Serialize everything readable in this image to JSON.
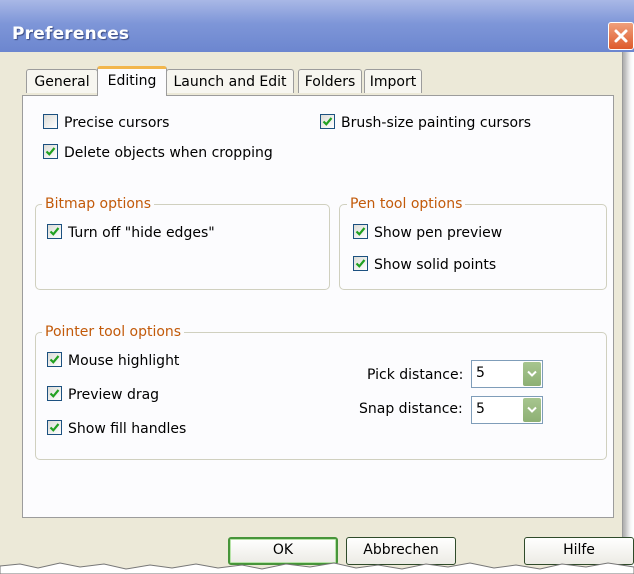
{
  "window": {
    "title": "Preferences"
  },
  "tabs": [
    {
      "label": "General"
    },
    {
      "label": "Editing",
      "active": true
    },
    {
      "label": "Launch and Edit"
    },
    {
      "label": "Folders"
    },
    {
      "label": "Import"
    }
  ],
  "editing": {
    "precise_cursors": {
      "label": "Precise cursors",
      "checked": false
    },
    "brush_size_cursors": {
      "label": "Brush-size painting cursors",
      "checked": true
    },
    "delete_objects_cropping": {
      "label": "Delete objects when cropping",
      "checked": true
    }
  },
  "bitmap_options": {
    "title": "Bitmap options",
    "turn_off_hide_edges": {
      "label": "Turn off \"hide edges\"",
      "checked": true
    }
  },
  "pen_tool_options": {
    "title": "Pen tool options",
    "show_pen_preview": {
      "label": "Show pen preview",
      "checked": true
    },
    "show_solid_points": {
      "label": "Show solid points",
      "checked": true
    }
  },
  "pointer_tool_options": {
    "title": "Pointer tool options",
    "mouse_highlight": {
      "label": "Mouse highlight",
      "checked": true
    },
    "preview_drag": {
      "label": "Preview drag",
      "checked": true
    },
    "show_fill_handles": {
      "label": "Show fill handles",
      "checked": true
    },
    "pick_distance": {
      "label": "Pick distance:",
      "value": "5"
    },
    "snap_distance": {
      "label": "Snap distance:",
      "value": "5"
    }
  },
  "buttons": {
    "ok": "OK",
    "cancel": "Abbrechen",
    "help": "Hilfe"
  },
  "colors": {
    "titlebar": "#7e96d8",
    "group_label": "#c25a0a",
    "check": "#21a121",
    "tab_highlight": "#f2b64c"
  }
}
